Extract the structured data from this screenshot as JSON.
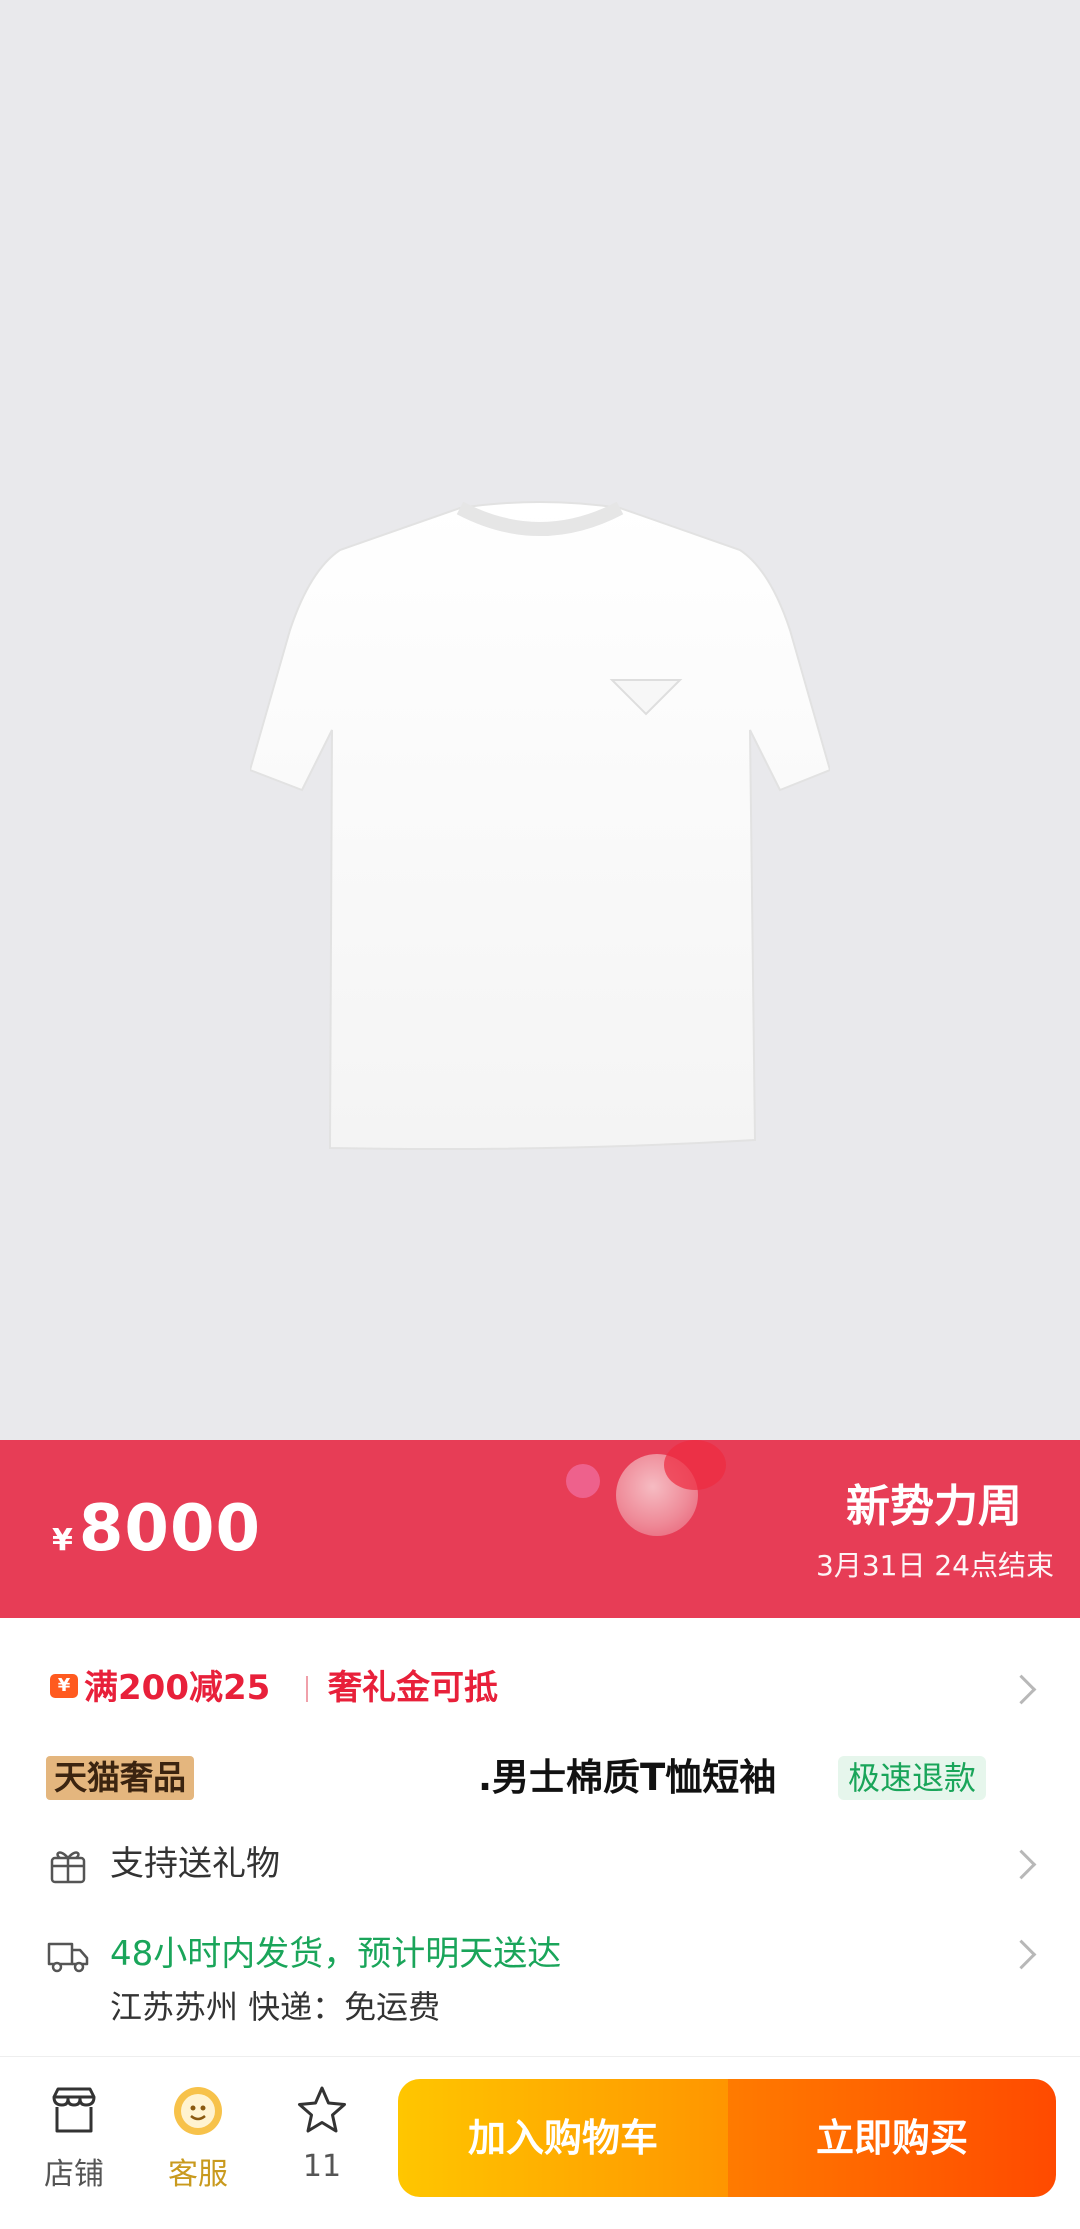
{
  "promo": {
    "currency": "¥",
    "price": "8000",
    "event_title": "新势力周",
    "event_end": "3月31日 24点结束",
    "color": "#e73d56"
  },
  "coupon": {
    "icon": "coupon-icon",
    "discount": "满200减25",
    "gift_money": "奢礼金可抵"
  },
  "product": {
    "badge": "天猫奢品",
    "title": ".男士棉质T恤短袖",
    "refund_tag": "极速退款"
  },
  "gift": {
    "icon": "gift-icon",
    "label": "支持送礼物"
  },
  "shipping": {
    "icon": "truck-icon",
    "delivery": "48小时内发货，预计明天送达",
    "detail": "江苏苏州  快递：免运费"
  },
  "bottom_bar": {
    "store": {
      "icon": "store-icon",
      "label": "店铺"
    },
    "service": {
      "icon": "customer-service-icon",
      "label": "客服"
    },
    "favorite": {
      "icon": "star-icon",
      "count": "11"
    },
    "add_to_cart": "加入购物车",
    "buy_now": "立即购买"
  }
}
